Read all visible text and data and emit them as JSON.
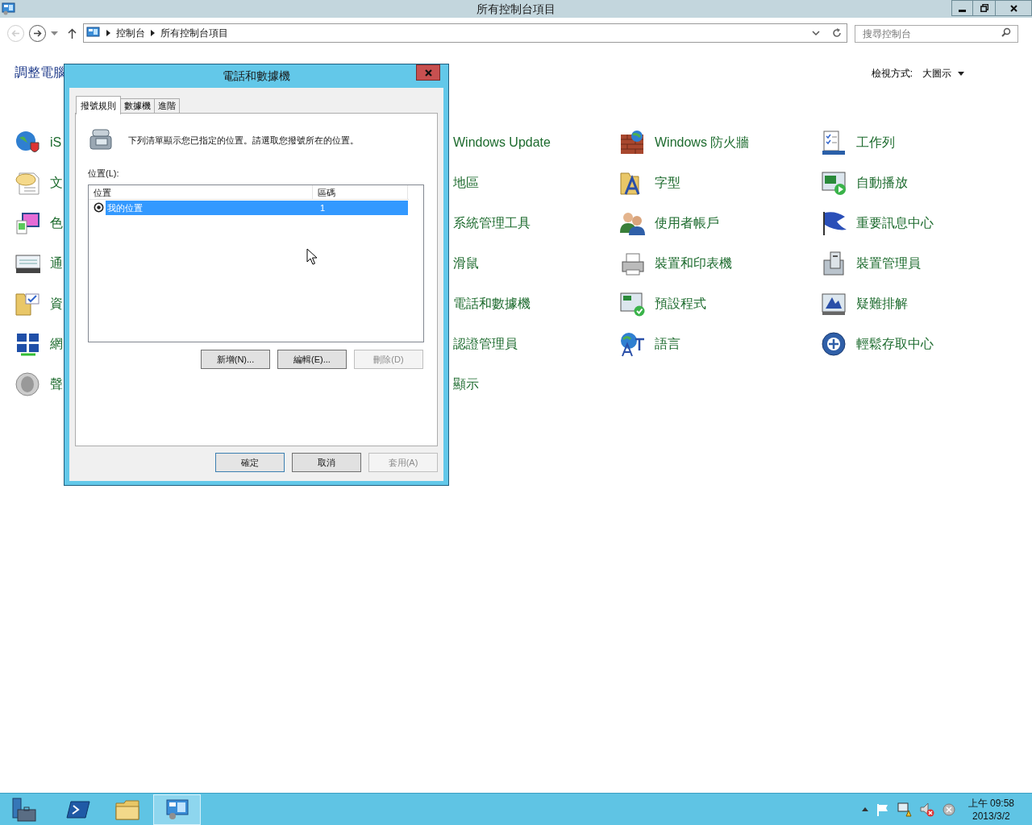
{
  "window": {
    "title": "所有控制台項目"
  },
  "address_bar": {
    "crumbs": [
      "控制台",
      "所有控制台項目"
    ]
  },
  "search": {
    "placeholder": "搜尋控制台"
  },
  "side_link": "調整電腦",
  "view": {
    "label": "檢視方式:",
    "value": "大圖示"
  },
  "columns": [
    {
      "items": [
        "iS",
        "文",
        "色",
        "通",
        "資",
        "網",
        "聲"
      ]
    },
    {
      "items": [
        "Windows Update",
        "地區",
        "系統管理工具",
        "滑鼠",
        "電話和數據機",
        "認證管理員",
        "顯示"
      ]
    },
    {
      "items": [
        "Windows 防火牆",
        "字型",
        "使用者帳戶",
        "裝置和印表機",
        "預設程式",
        "語言"
      ]
    },
    {
      "items": [
        "工作列",
        "自動播放",
        "重要訊息中心",
        "裝置管理員",
        "疑難排解",
        "輕鬆存取中心"
      ]
    }
  ],
  "dialog": {
    "title": "電話和數據機",
    "tabs": [
      {
        "label": "撥號規則",
        "selected": true
      },
      {
        "label": "數據機",
        "selected": false
      },
      {
        "label": "進階",
        "selected": false
      }
    ],
    "description": "下列清單顯示您已指定的位置。請選取您撥號所在的位置。",
    "list_label": "位置(L):",
    "list_columns": [
      "位置",
      "區碼"
    ],
    "rows": [
      {
        "location": "我的位置",
        "area_code": "1",
        "selected": true
      }
    ],
    "list_buttons": [
      {
        "label": "新增(N)...",
        "disabled": false
      },
      {
        "label": "編輯(E)...",
        "disabled": false
      },
      {
        "label": "刪除(D)",
        "disabled": true
      }
    ],
    "buttons": [
      {
        "label": "確定",
        "disabled": false,
        "default": true
      },
      {
        "label": "取消",
        "disabled": false,
        "default": false
      },
      {
        "label": "套用(A)",
        "disabled": true,
        "default": false
      }
    ]
  },
  "taskbar": {
    "time": "上午 09:58",
    "date": "2013/3/2"
  }
}
